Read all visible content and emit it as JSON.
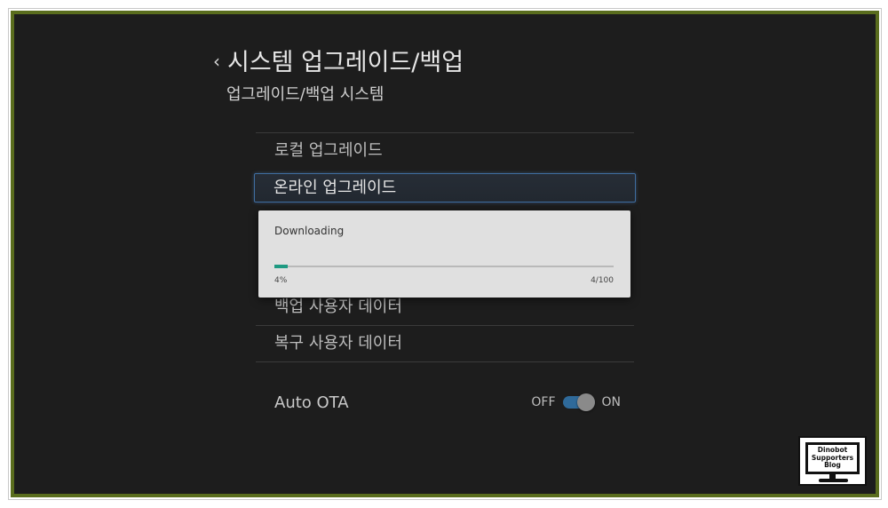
{
  "header": {
    "title": "시스템 업그레이드/백업",
    "subtitle": "업그레이드/백업 시스템"
  },
  "menu": {
    "items": [
      {
        "label": "로컬 업그레이드"
      },
      {
        "label": "온라인 업그레이드",
        "selected": true
      },
      {
        "label": "백업 사용자 데이터"
      },
      {
        "label": "복구 사용자 데이터"
      }
    ]
  },
  "auto_ota": {
    "label": "Auto OTA",
    "off_label": "OFF",
    "on_label": "ON",
    "state": "on"
  },
  "dialog": {
    "title": "Downloading",
    "progress_fraction": 0.04,
    "percent_text": "4%",
    "count_text": "4/100"
  },
  "watermark": {
    "line1": "Dinobot",
    "line2": "Supporters",
    "line3": "Blog"
  },
  "colors": {
    "frame_border": "#5a6d1e",
    "background": "#1d1d1d",
    "selected_border": "#3f6da0",
    "progress_fill": "#1f9a82",
    "toggle_track": "#2f6a9a"
  }
}
